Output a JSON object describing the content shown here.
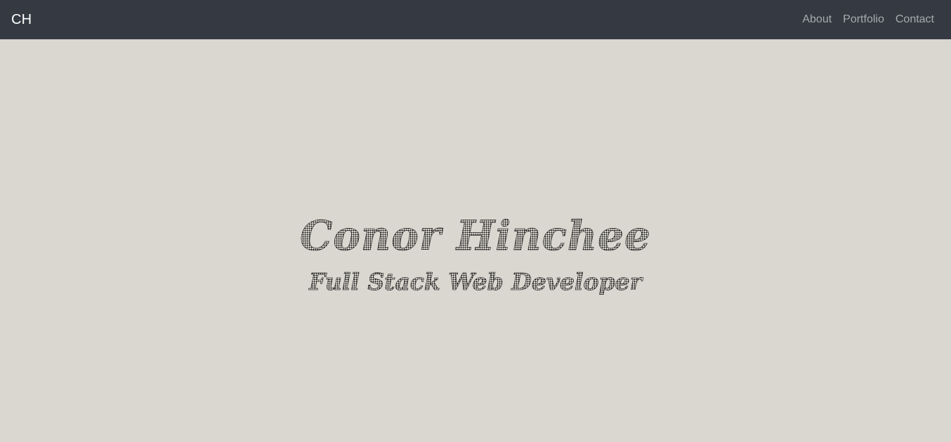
{
  "navbar": {
    "brand": "CH",
    "links": [
      {
        "label": "About"
      },
      {
        "label": "Portfolio"
      },
      {
        "label": "Contact"
      }
    ]
  },
  "hero": {
    "title": "Conor Hinchee",
    "subtitle": "Full Stack Web Developer"
  },
  "colors": {
    "navbar_bg": "#353a42",
    "page_bg": "#dad7d0",
    "brand_text": "#ffffff",
    "nav_link_text": "#a7a9ad",
    "hero_text": "#111111"
  }
}
